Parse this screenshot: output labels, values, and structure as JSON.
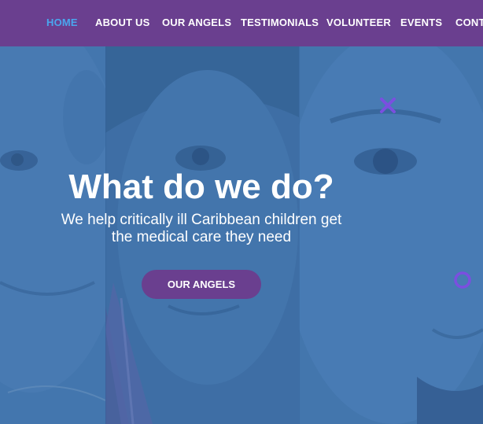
{
  "nav": {
    "items": [
      {
        "label": "HOME",
        "active": true
      },
      {
        "label": "ABOUT US",
        "active": false
      },
      {
        "label": "OUR ANGELS",
        "active": false
      },
      {
        "label": "TESTIMONIALS",
        "active": false
      },
      {
        "label": "VOLUNTEER",
        "active": false
      },
      {
        "label": "EVENTS",
        "active": false
      },
      {
        "label": "CONTA",
        "active": false
      }
    ]
  },
  "hero": {
    "headline": "What do we do?",
    "subline_1": "We help critically ill Caribbean children get",
    "subline_2": "the medical care they need",
    "cta_label": "OUR ANGELS"
  },
  "colors": {
    "nav_bg": "#6a3f8f",
    "nav_active": "#4aa6ee",
    "overlay": "#3f73a8",
    "cta_bg": "#6a3f8f",
    "decor": "#7b4fe0"
  },
  "icons": [
    "close-x-decor-icon",
    "circle-decor-icon"
  ]
}
